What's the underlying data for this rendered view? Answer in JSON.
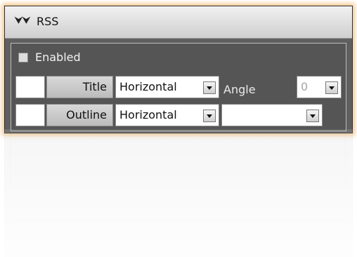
{
  "panel": {
    "title": "RSS",
    "collapse_icon": "double-chevron-down-icon",
    "enabled_label": "Enabled",
    "rows": [
      {
        "label": "Title",
        "orientation": "Horizontal"
      },
      {
        "label": "Outline",
        "orientation": "Horizontal"
      }
    ],
    "angle": {
      "label": "Angle",
      "value": "0"
    },
    "outline_extra_value": ""
  },
  "colors": {
    "panel_bg": "#5f5f5f",
    "header_bg": "#e2e2e2",
    "glow": "#f0aa50"
  }
}
